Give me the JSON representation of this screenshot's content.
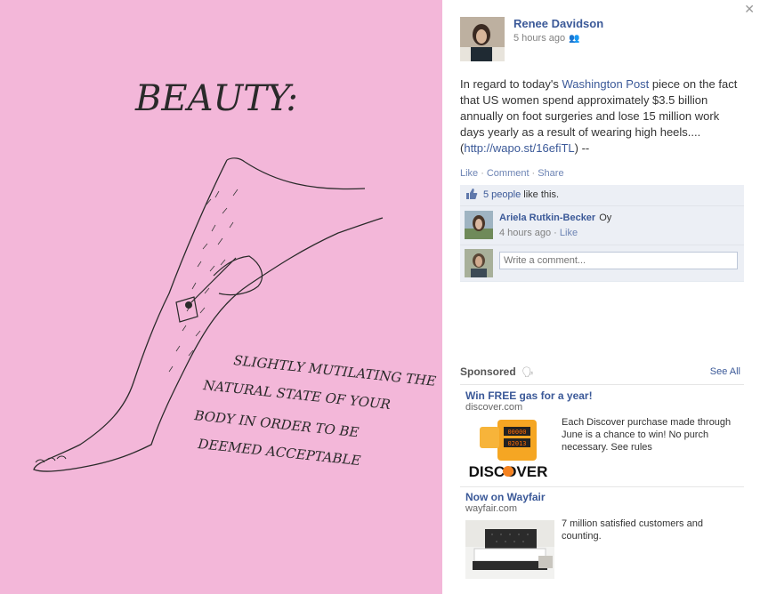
{
  "photo": {
    "title": "BEAUTY:",
    "caption_lines": [
      "SLIGHTLY MUTILATING THE",
      "NATURAL STATE OF YOUR",
      "BODY IN ORDER TO BE",
      "DEEMED ACCEPTABLE"
    ]
  },
  "post": {
    "author": "Renee Davidson",
    "time": "5 hours ago",
    "text_before": "In regard to today's ",
    "link_wapo": "Washington Post",
    "text_middle": " piece on the fact that US women spend approximately $3.5 billion annually on foot surgeries and lose 15 million work days yearly as a result of wearing high heels.... (",
    "link_url": "http://wapo.st/16efiTL",
    "text_after": ") --",
    "actions": {
      "like": "Like",
      "comment": "Comment",
      "share": "Share"
    },
    "likes": {
      "count_link": "5 people",
      "suffix": " like this."
    },
    "comments": [
      {
        "name": "Ariela Rutkin-Becker",
        "text": "Oy",
        "time": "4 hours ago",
        "like": "Like"
      }
    ],
    "comment_placeholder": "Write a comment..."
  },
  "sponsored": {
    "heading": "Sponsored",
    "see_all": "See All",
    "ads": [
      {
        "title": "Win FREE gas for a year!",
        "url": "discover.com",
        "body": "Each Discover purchase made through June is a chance to win! No purch necessary. See rules",
        "brand": "DISCOVER",
        "digits_top": "00000",
        "digits_bottom": "02013"
      },
      {
        "title": "Now on Wayfair",
        "url": "wayfair.com",
        "body": "7 million satisfied customers and counting."
      }
    ]
  },
  "colors": {
    "link": "#3b5998",
    "photo_bg": "#f3b7d9",
    "ufi_bg": "#eceff5"
  }
}
